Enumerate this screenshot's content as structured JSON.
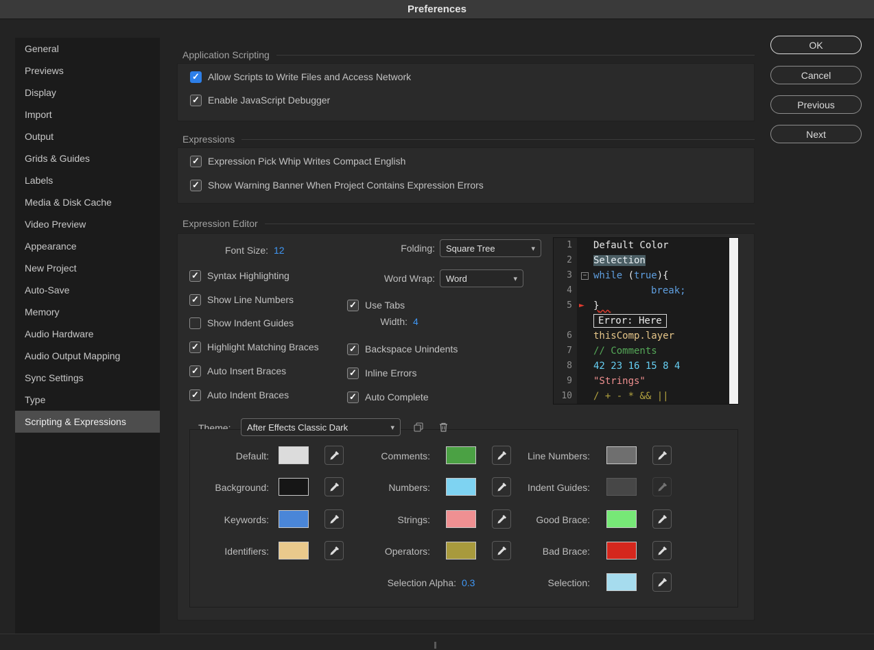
{
  "titlebar": {
    "title": "Preferences"
  },
  "sidebar": {
    "items": [
      "General",
      "Previews",
      "Display",
      "Import",
      "Output",
      "Grids & Guides",
      "Labels",
      "Media & Disk Cache",
      "Video Preview",
      "Appearance",
      "New Project",
      "Auto-Save",
      "Memory",
      "Audio Hardware",
      "Audio Output Mapping",
      "Sync Settings",
      "Type",
      "Scripting & Expressions"
    ],
    "selected_index": 17
  },
  "buttons": {
    "ok": "OK",
    "cancel": "Cancel",
    "previous": "Previous",
    "next": "Next"
  },
  "app_scripting": {
    "title": "Application Scripting",
    "rows": [
      {
        "label": "Allow Scripts to Write Files and Access Network",
        "checked": true
      },
      {
        "label": "Enable JavaScript Debugger",
        "checked": true
      }
    ]
  },
  "expressions": {
    "title": "Expressions",
    "rows": [
      {
        "label": "Expression Pick Whip Writes Compact English",
        "checked": true
      },
      {
        "label": "Show Warning Banner When Project Contains Expression Errors",
        "checked": true
      }
    ]
  },
  "editor": {
    "title": "Expression Editor",
    "font_size": {
      "label": "Font Size:",
      "value": "12"
    },
    "folding": {
      "label": "Folding:",
      "value": "Square Tree"
    },
    "word_wrap": {
      "label": "Word Wrap:",
      "value": "Word"
    },
    "width": {
      "label": "Width:",
      "value": "4"
    },
    "checks": {
      "syntax": "Syntax Highlighting",
      "line_numbers": "Show Line Numbers",
      "indent_guides": "Show Indent Guides",
      "matching_braces": "Highlight Matching Braces",
      "auto_insert": "Auto Insert Braces",
      "auto_indent": "Auto Indent Braces",
      "use_tabs": "Use Tabs",
      "backspace": "Backspace Unindents",
      "inline_errors": "Inline Errors",
      "auto_complete": "Auto Complete"
    }
  },
  "code": {
    "gutter": [
      "1",
      "2",
      "3",
      "4",
      "5",
      "6",
      "7",
      "8",
      "9",
      "10"
    ],
    "l1": "Default Color",
    "l2": "Selection",
    "l3a": "while",
    "l3b": " (",
    "l3c": "true",
    "l3d": "){",
    "l4": "break;",
    "l5": "}",
    "error": "Error: Here",
    "l6": "thisComp.layer",
    "l7": "// Comments",
    "l8": "42 23 16 15 8 4",
    "l9": "\"Strings\"",
    "l10": "/ + - * && ||"
  },
  "theme": {
    "label": "Theme:",
    "value": "After Effects Classic Dark"
  },
  "swatches": {
    "default": {
      "label": "Default:",
      "hex": "#dcdcdc"
    },
    "comments": {
      "label": "Comments:",
      "hex": "#4ba144"
    },
    "line_numbers": {
      "label": "Line Numbers:",
      "hex": "#6f6f6f"
    },
    "background": {
      "label": "Background:",
      "hex": "#161616"
    },
    "numbers": {
      "label": "Numbers:",
      "hex": "#7ed3f2"
    },
    "indent_guides": {
      "label": "Indent Guides:",
      "hex": "#474747"
    },
    "keywords": {
      "label": "Keywords:",
      "hex": "#4a86d8"
    },
    "strings": {
      "label": "Strings:",
      "hex": "#ef9092"
    },
    "good_brace": {
      "label": "Good Brace:",
      "hex": "#77e877"
    },
    "identifiers": {
      "label": "Identifiers:",
      "hex": "#e9c98c"
    },
    "operators": {
      "label": "Operators:",
      "hex": "#a89a3d"
    },
    "bad_brace": {
      "label": "Bad Brace:",
      "hex": "#d5271d"
    },
    "selection": {
      "label": "Selection:",
      "hex": "#a6dcee"
    }
  },
  "selection_alpha": {
    "label": "Selection Alpha:",
    "value": "0.3"
  },
  "accent": {
    "blue": "#3f97f5",
    "checkbox_blue": "#2d7fe8",
    "error_red": "#e23b2e"
  }
}
